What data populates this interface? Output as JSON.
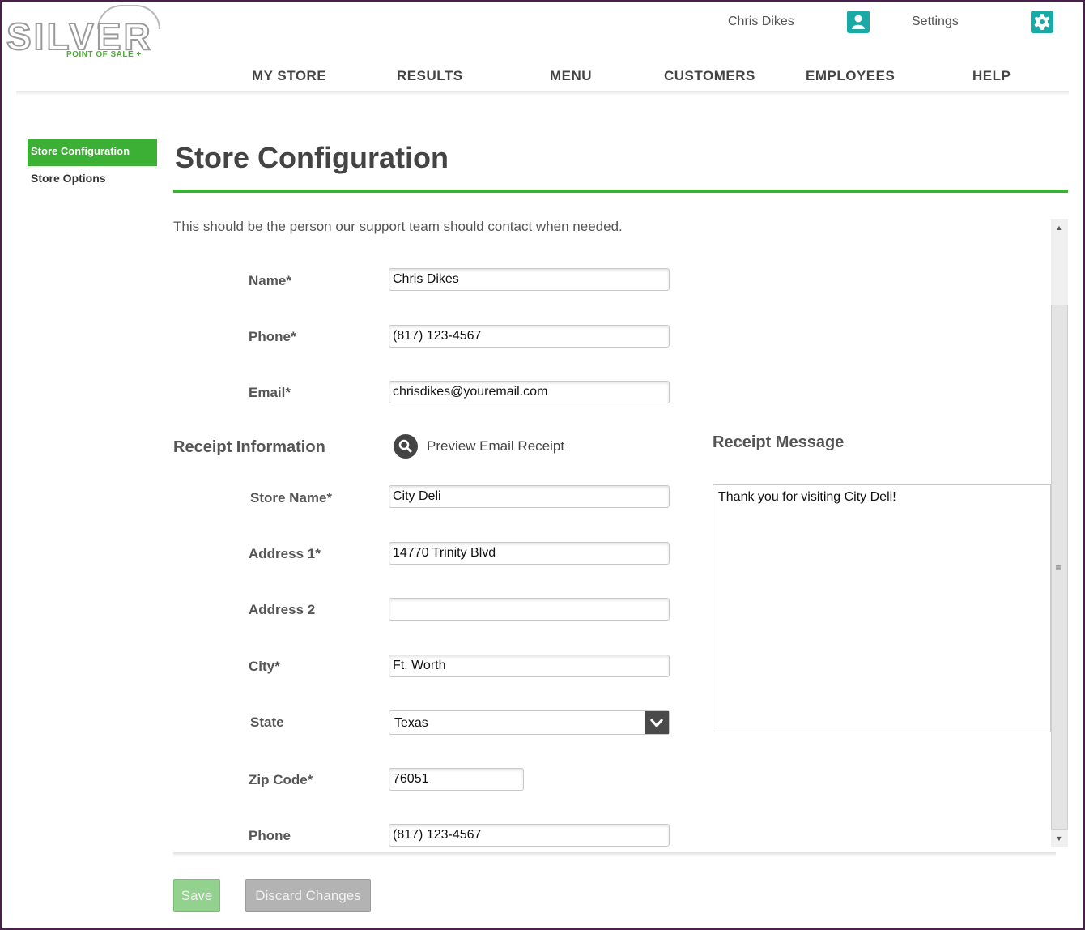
{
  "logo": {
    "name": "SILVER",
    "tagline": "POINT OF SALE +"
  },
  "header": {
    "user_name": "Chris Dikes",
    "settings_label": "Settings",
    "user_icon": "user-icon",
    "settings_icon": "gear-icon",
    "accent_color": "#1aa9a4"
  },
  "nav": {
    "items": [
      "MY STORE",
      "RESULTS",
      "MENU",
      "CUSTOMERS",
      "EMPLOYEES",
      "HELP"
    ]
  },
  "sidebar": {
    "items": [
      {
        "label": "Store Configuration",
        "active": true
      },
      {
        "label": "Store Options",
        "active": false
      }
    ],
    "active_color": "#3cb034"
  },
  "main": {
    "title": "Store Configuration",
    "intro": "This should be the person our support team should contact when needed.",
    "contact": {
      "name_label": "Name*",
      "name_value": "Chris Dikes",
      "phone_label": "Phone*",
      "phone_value": "(817) 123-4567",
      "email_label": "Email*",
      "email_value": "chrisdikes@youremail.com"
    },
    "receipt": {
      "heading": "Receipt Information",
      "preview_label": "Preview Email Receipt",
      "preview_icon": "magnifier-icon",
      "message_heading": "Receipt Message",
      "message_value": "Thank you for visiting City Deli!",
      "store_name_label": "Store Name*",
      "store_name_value": "City Deli",
      "address1_label": "Address 1*",
      "address1_value": "14770 Trinity Blvd",
      "address2_label": "Address 2",
      "address2_value": "",
      "city_label": "City*",
      "city_value": "Ft. Worth",
      "state_label": "State",
      "state_value": "Texas",
      "zip_label": "Zip Code*",
      "zip_value": "76051",
      "phone_label": "Phone",
      "phone_value": "(817) 123-4567"
    }
  },
  "actions": {
    "save_label": "Save",
    "discard_label": "Discard Changes"
  }
}
